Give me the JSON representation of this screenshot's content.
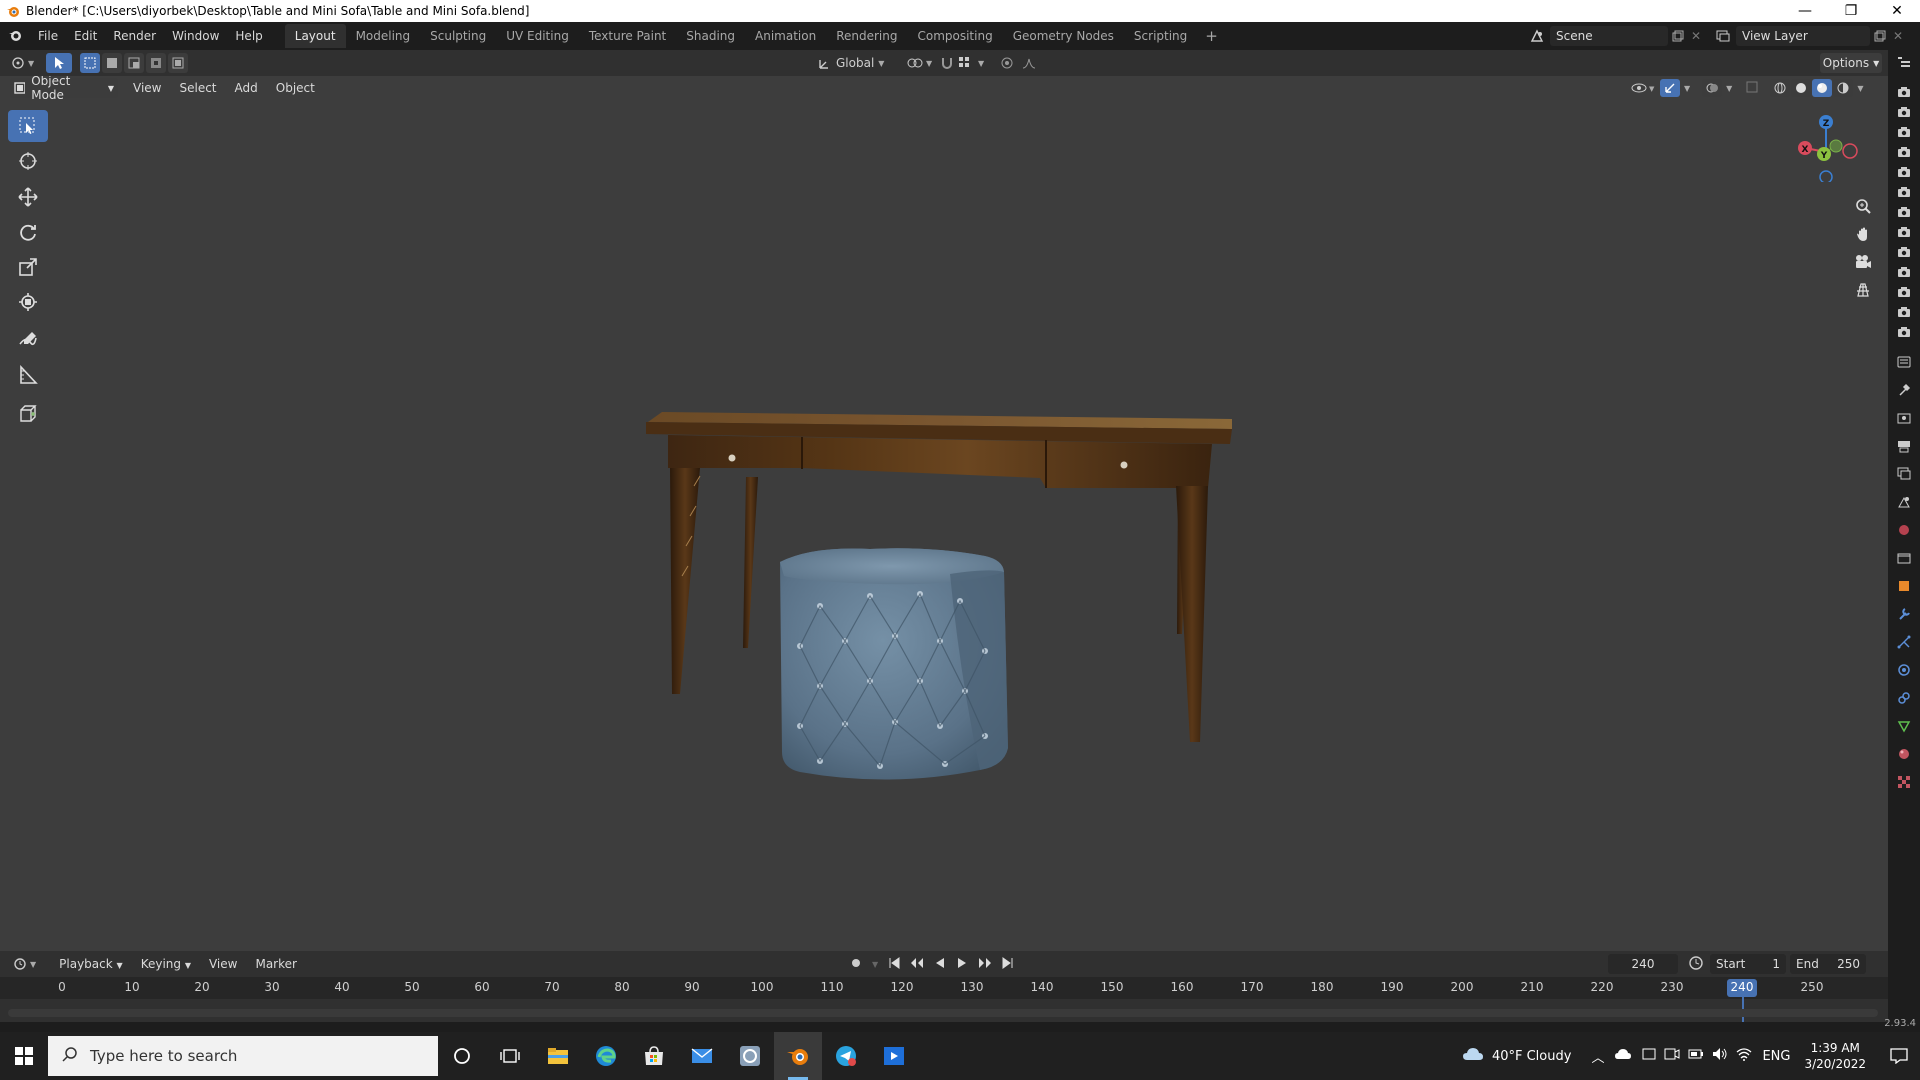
{
  "window": {
    "title": "Blender* [C:\\Users\\diyorbek\\Desktop\\Table and Mini Sofa\\Table and Mini Sofa.blend]",
    "minimize": "—",
    "maximize": "❐",
    "close": "✕"
  },
  "menu": [
    "File",
    "Edit",
    "Render",
    "Window",
    "Help"
  ],
  "workspaces": [
    "Layout",
    "Modeling",
    "Sculpting",
    "UV Editing",
    "Texture Paint",
    "Shading",
    "Animation",
    "Rendering",
    "Compositing",
    "Geometry Nodes",
    "Scripting"
  ],
  "active_workspace": "Layout",
  "scene": {
    "label": "Scene"
  },
  "view_layer": {
    "label": "View Layer"
  },
  "tool_header": {
    "orientation": "Global",
    "options": "Options"
  },
  "viewport_header": {
    "mode": "Object Mode",
    "menus": [
      "View",
      "Select",
      "Add",
      "Object"
    ]
  },
  "gizmo": {
    "x": "X",
    "y": "Y",
    "z": "Z"
  },
  "timeline": {
    "menus": [
      "Playback",
      "Keying",
      "View",
      "Marker"
    ],
    "current_frame": "240",
    "start_label": "Start",
    "start_value": "1",
    "end_label": "End",
    "end_value": "250",
    "ticks": [
      "0",
      "10",
      "20",
      "30",
      "40",
      "50",
      "60",
      "70",
      "80",
      "90",
      "100",
      "110",
      "120",
      "130",
      "140",
      "150",
      "160",
      "170",
      "180",
      "190",
      "200",
      "210",
      "220",
      "230",
      "240",
      "250"
    ]
  },
  "version": "2.93.4",
  "taskbar": {
    "search_placeholder": "Type here to search",
    "weather": "40°F  Cloudy",
    "lang": "ENG",
    "time": "1:39 AM",
    "date": "3/20/2022"
  },
  "colors": {
    "accent": "#4772b3",
    "viewport_bg": "#3d3d3d",
    "table_wood": "#5a3a1c",
    "pouf": "#5d7488"
  }
}
